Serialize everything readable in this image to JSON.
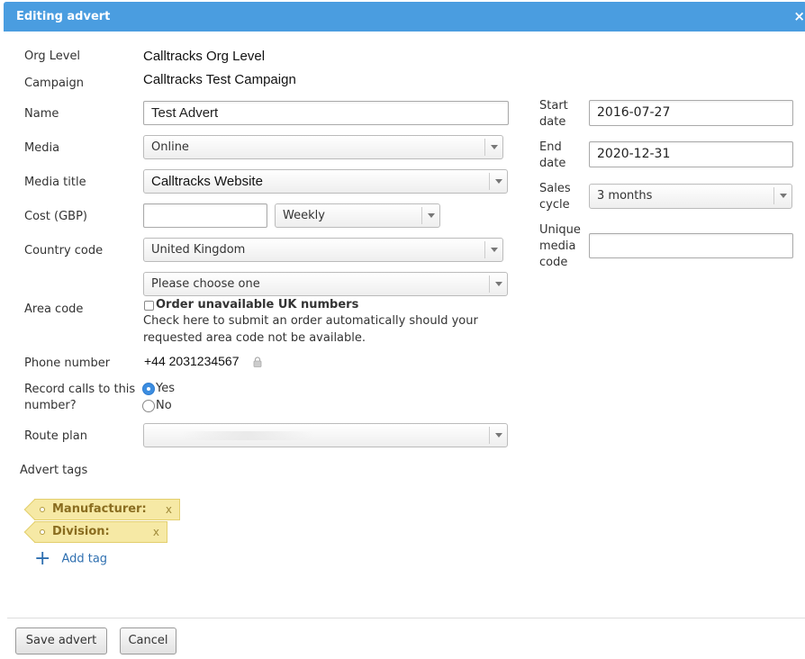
{
  "dialog": {
    "title": "Editing advert",
    "close": "×"
  },
  "form": {
    "org_level": {
      "label": "Org Level",
      "value": "Calltracks Org Level"
    },
    "campaign": {
      "label": "Campaign",
      "value": "Calltracks Test Campaign"
    },
    "name": {
      "label": "Name",
      "value": "Test Advert"
    },
    "media": {
      "label": "Media",
      "value": "Online"
    },
    "media_title": {
      "label": "Media title",
      "value": "Calltracks Website"
    },
    "cost": {
      "label": "Cost (GBP)",
      "value": "",
      "frequency": "Weekly"
    },
    "country_code": {
      "label": "Country code",
      "value": "United Kingdom"
    },
    "area_code": {
      "label": "Area code",
      "value": "Please choose one",
      "checkbox_label": "Order unavailable UK numbers",
      "checkbox_checked": false,
      "help_line1": "Check here to submit an order automatically should your",
      "help_line2": "requested area code not be available."
    },
    "phone_number": {
      "label": "Phone number",
      "value": "+44 2031234567",
      "icon": "lock-icon"
    },
    "record_calls": {
      "label_line1": "Record calls to this",
      "label_line2": "number?",
      "options": [
        {
          "label": "Yes",
          "selected": true
        },
        {
          "label": "No",
          "selected": false
        }
      ]
    },
    "route_plan": {
      "label": "Route plan",
      "value": ""
    },
    "advert_tags": {
      "label": "Advert tags",
      "tags": [
        {
          "label": "Manufacturer:",
          "remove": "x"
        },
        {
          "label": "Division:",
          "remove": "x"
        }
      ],
      "add_label": "Add tag",
      "add_icon": "+"
    }
  },
  "side": {
    "start_date": {
      "label_line1": "Start",
      "label_line2": "date",
      "value": "2016-07-27"
    },
    "end_date": {
      "label_line1": "End",
      "label_line2": "date",
      "value": "2020-12-31"
    },
    "sales_cycle": {
      "label_line1": "Sales",
      "label_line2": "cycle",
      "value": "3 months"
    },
    "unique_media_code": {
      "label_line1": "Unique",
      "label_line2": "media",
      "label_line3": "code",
      "value": ""
    }
  },
  "footer": {
    "save_label": "Save advert",
    "cancel_label": "Cancel"
  },
  "colors": {
    "titlebar": "#4a9de0",
    "tag_bg": "#f6e9a5",
    "link": "#2e6fb0",
    "radio_on": "#3c8de0"
  }
}
